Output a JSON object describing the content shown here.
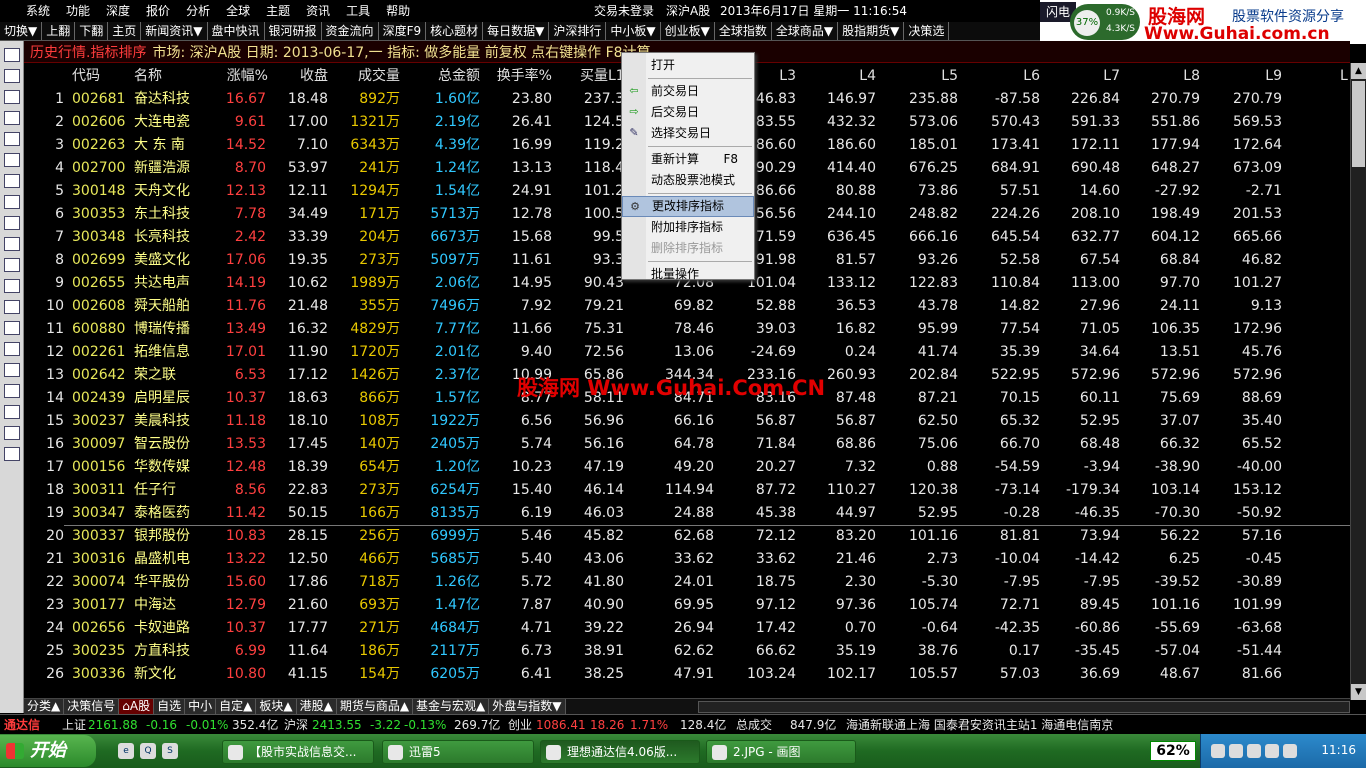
{
  "menu": [
    "系统",
    "功能",
    "深度",
    "报价",
    "分析",
    "全球",
    "主题",
    "资讯",
    "工具",
    "帮助"
  ],
  "status": {
    "trade": "交易未登录",
    "market": "深沪A股",
    "datetime": "2013年6月17日 星期一 11:16:54",
    "flash": "闪电"
  },
  "gauge": {
    "pct": "37%",
    "up": "0.9K/S",
    "down": "4.3K/S"
  },
  "brand": {
    "name": "股海网",
    "slogan": "股票软件资源分享",
    "url": "Www.Guhai.com.cn"
  },
  "toolbar": [
    "切换▼",
    "上翻",
    "下翻",
    "主页",
    "新闻资讯▼",
    "盘中快讯",
    "银河研报",
    "资金流向",
    "深度F9",
    "核心题材",
    "每日数据▼",
    "沪深排行",
    "中小板▼",
    "创业板▼",
    "全球指数",
    "全球商品▼",
    "股指期货▼",
    "决策选"
  ],
  "left_icons": [
    "list",
    "grid",
    "chart",
    "kline",
    "table",
    "fin",
    "doc",
    "doc2",
    "fin2",
    "f10",
    "search",
    "sel",
    "edit",
    "edit2",
    "note",
    "open",
    "tool",
    "back",
    "fwd",
    "setting"
  ],
  "titlebar": {
    "label": "历史行情.指标排序",
    "info": "市场: 深沪A股 日期: 2013-06-17,一 指标: 做多能量 前复权 点右键操作 F8计算"
  },
  "columns": [
    "",
    "代码",
    "名称",
    "涨幅%",
    "收盘",
    "成交量",
    "总金额",
    "换手率%",
    "买量L1",
    "L2",
    "L3",
    "L4",
    "L5",
    "L6",
    "L7",
    "L8",
    "L9",
    "L"
  ],
  "rows": [
    [
      "1",
      "002681",
      "奋达科技",
      "16.67",
      "18.48",
      "892万",
      "1.60亿",
      "23.80",
      "237.3",
      "",
      "246.83",
      "146.97",
      "235.88",
      "-87.58",
      "226.84",
      "270.79",
      "270.79"
    ],
    [
      "2",
      "002606",
      "大连电瓷",
      "9.61",
      "17.00",
      "1321万",
      "2.19亿",
      "26.41",
      "124.5",
      "",
      "183.55",
      "432.32",
      "573.06",
      "570.43",
      "591.33",
      "551.86",
      "569.53"
    ],
    [
      "3",
      "002263",
      "大 东 南",
      "14.52",
      "7.10",
      "6343万",
      "4.39亿",
      "16.99",
      "119.2",
      "",
      "186.60",
      "186.60",
      "185.01",
      "173.41",
      "172.11",
      "177.94",
      "172.64"
    ],
    [
      "4",
      "002700",
      "新疆浩源",
      "8.70",
      "53.97",
      "241万",
      "1.24亿",
      "13.13",
      "118.4",
      "",
      "390.29",
      "414.40",
      "676.25",
      "684.91",
      "690.48",
      "648.27",
      "673.09"
    ],
    [
      "5",
      "300148",
      "天舟文化",
      "12.13",
      "12.11",
      "1294万",
      "1.54亿",
      "24.91",
      "101.2",
      "",
      "86.66",
      "80.88",
      "73.86",
      "57.51",
      "14.60",
      "-27.92",
      "-2.71"
    ],
    [
      "6",
      "300353",
      "东土科技",
      "7.78",
      "34.49",
      "171万",
      "5713万",
      "12.78",
      "100.5",
      "",
      "256.56",
      "244.10",
      "248.82",
      "224.26",
      "208.10",
      "198.49",
      "201.53"
    ],
    [
      "7",
      "300348",
      "长亮科技",
      "2.42",
      "33.39",
      "204万",
      "6673万",
      "15.68",
      "99.5",
      "",
      "671.59",
      "636.45",
      "666.16",
      "645.54",
      "632.77",
      "604.12",
      "665.66"
    ],
    [
      "8",
      "002699",
      "美盛文化",
      "17.06",
      "19.35",
      "273万",
      "5097万",
      "11.61",
      "93.3",
      "",
      "91.98",
      "81.57",
      "93.26",
      "52.58",
      "67.54",
      "68.84",
      "46.82"
    ],
    [
      "9",
      "002655",
      "共达电声",
      "14.19",
      "10.62",
      "1989万",
      "2.06亿",
      "14.95",
      "90.43",
      "72.08",
      "101.04",
      "133.12",
      "122.83",
      "110.84",
      "113.00",
      "97.70",
      "101.27"
    ],
    [
      "10",
      "002608",
      "舜天船舶",
      "11.76",
      "21.48",
      "355万",
      "7496万",
      "7.92",
      "79.21",
      "69.82",
      "52.88",
      "36.53",
      "43.78",
      "14.82",
      "27.96",
      "24.11",
      "9.13"
    ],
    [
      "11",
      "600880",
      "博瑞传播",
      "13.49",
      "16.32",
      "4829万",
      "7.77亿",
      "11.66",
      "75.31",
      "78.46",
      "39.03",
      "16.82",
      "95.99",
      "77.54",
      "71.05",
      "106.35",
      "172.96"
    ],
    [
      "12",
      "002261",
      "拓维信息",
      "17.01",
      "11.90",
      "1720万",
      "2.01亿",
      "9.40",
      "72.56",
      "13.06",
      "-24.69",
      "0.24",
      "41.74",
      "35.39",
      "34.64",
      "13.51",
      "45.76"
    ],
    [
      "13",
      "002642",
      "荣之联",
      "6.53",
      "17.12",
      "1426万",
      "2.37亿",
      "10.99",
      "65.86",
      "344.34",
      "233.16",
      "260.93",
      "202.84",
      "522.95",
      "572.96",
      "572.96",
      "572.96"
    ],
    [
      "14",
      "002439",
      "启明星辰",
      "10.37",
      "18.63",
      "866万",
      "1.57亿",
      "8.77",
      "58.11",
      "84.71",
      "83.16",
      "87.48",
      "87.21",
      "70.15",
      "60.11",
      "75.69",
      "88.69"
    ],
    [
      "15",
      "300237",
      "美晨科技",
      "11.18",
      "18.10",
      "108万",
      "1922万",
      "6.56",
      "56.96",
      "66.16",
      "56.87",
      "56.87",
      "62.50",
      "65.32",
      "52.95",
      "37.07",
      "35.40"
    ],
    [
      "16",
      "300097",
      "智云股份",
      "13.53",
      "17.45",
      "140万",
      "2405万",
      "5.74",
      "56.16",
      "64.78",
      "71.84",
      "68.86",
      "75.06",
      "66.70",
      "68.48",
      "66.32",
      "65.52"
    ],
    [
      "17",
      "000156",
      "华数传媒",
      "12.48",
      "18.39",
      "654万",
      "1.20亿",
      "10.23",
      "47.19",
      "49.20",
      "20.27",
      "7.32",
      "0.88",
      "-54.59",
      "-3.94",
      "-38.90",
      "-40.00"
    ],
    [
      "18",
      "300311",
      "任子行",
      "8.56",
      "22.83",
      "273万",
      "6254万",
      "15.40",
      "46.14",
      "114.94",
      "87.72",
      "110.27",
      "120.38",
      "-73.14",
      "-179.34",
      "103.14",
      "153.12"
    ],
    [
      "19",
      "300347",
      "泰格医药",
      "11.42",
      "50.15",
      "166万",
      "8135万",
      "6.19",
      "46.03",
      "24.88",
      "45.38",
      "44.97",
      "52.95",
      "-0.28",
      "-46.35",
      "-70.30",
      "-50.92"
    ],
    [
      "20",
      "300337",
      "银邦股份",
      "10.83",
      "28.15",
      "256万",
      "6999万",
      "5.46",
      "45.82",
      "62.68",
      "72.12",
      "83.20",
      "101.16",
      "81.81",
      "73.94",
      "56.22",
      "57.16"
    ],
    [
      "21",
      "300316",
      "晶盛机电",
      "13.22",
      "12.50",
      "466万",
      "5685万",
      "5.40",
      "43.06",
      "33.62",
      "33.62",
      "21.46",
      "2.73",
      "-10.04",
      "-14.42",
      "6.25",
      "-0.45"
    ],
    [
      "22",
      "300074",
      "华平股份",
      "15.60",
      "17.86",
      "718万",
      "1.26亿",
      "5.72",
      "41.80",
      "24.01",
      "18.75",
      "2.30",
      "-5.30",
      "-7.95",
      "-7.95",
      "-39.52",
      "-30.89"
    ],
    [
      "23",
      "300177",
      "中海达",
      "12.79",
      "21.60",
      "693万",
      "1.47亿",
      "7.87",
      "40.90",
      "69.95",
      "97.12",
      "97.36",
      "105.74",
      "72.71",
      "89.45",
      "101.16",
      "101.99"
    ],
    [
      "24",
      "002656",
      "卡奴迪路",
      "10.37",
      "17.77",
      "271万",
      "4684万",
      "4.71",
      "39.22",
      "26.94",
      "17.42",
      "0.70",
      "-0.64",
      "-42.35",
      "-60.86",
      "-55.69",
      "-63.68"
    ],
    [
      "25",
      "300235",
      "方直科技",
      "6.99",
      "11.64",
      "186万",
      "2117万",
      "6.73",
      "38.91",
      "62.62",
      "66.62",
      "35.19",
      "38.76",
      "0.17",
      "-35.45",
      "-57.04",
      "-51.44"
    ],
    [
      "26",
      "300336",
      "新文化",
      "10.80",
      "41.15",
      "154万",
      "6205万",
      "6.41",
      "38.25",
      "47.91",
      "103.24",
      "102.17",
      "105.57",
      "57.03",
      "36.69",
      "48.67",
      "81.66"
    ]
  ],
  "watermark": "股海网 Www.Guhai.Com.CN",
  "context_menu": [
    {
      "label": "打开",
      "icon": "",
      "shortcut": "",
      "state": ""
    },
    {
      "divider": true
    },
    {
      "label": "前交易日",
      "icon": "left-arrow",
      "shortcut": "",
      "state": ""
    },
    {
      "label": "后交易日",
      "icon": "right-arrow",
      "shortcut": "",
      "state": ""
    },
    {
      "label": "选择交易日",
      "icon": "tool",
      "shortcut": "",
      "state": ""
    },
    {
      "divider": true
    },
    {
      "label": "重新计算",
      "icon": "",
      "shortcut": "F8",
      "state": ""
    },
    {
      "label": "动态股票池模式",
      "icon": "",
      "shortcut": "",
      "state": ""
    },
    {
      "divider": true
    },
    {
      "label": "更改排序指标",
      "icon": "setting",
      "shortcut": "",
      "state": "sel"
    },
    {
      "label": "附加排序指标",
      "icon": "",
      "shortcut": "",
      "state": ""
    },
    {
      "label": "删除排序指标",
      "icon": "",
      "shortcut": "",
      "state": "dis"
    },
    {
      "divider": true
    },
    {
      "label": "批量操作",
      "icon": "",
      "shortcut": "",
      "state": ""
    }
  ],
  "tabs": [
    "分类▲",
    "决策信号",
    "⌂A股",
    "自选",
    "中小",
    "自定▲",
    "板块▲",
    "港股▲",
    "期货与商品▲",
    "基金与宏观▲",
    "外盘与指数▼"
  ],
  "statusbar": {
    "app": "通达信",
    "sh_label": "上证",
    "sh_val": "2161.88",
    "sh_chg": "-0.16",
    "sh_pct": "-0.01%",
    "sh_amt": "352.4亿",
    "sz_label": "沪深",
    "sz_val": "2413.55",
    "sz_chg": "-3.22",
    "sz_pct": "-0.13%",
    "sz_amt": "269.7亿",
    "cy_label": "创业",
    "cy_val": "1086.41",
    "cy_chg": "18.26",
    "cy_pct": "1.71%",
    "cy_amt": "128.4亿",
    "total_label": "总成交",
    "total_amt": "847.9亿",
    "news": "海通新联通上海 国泰君安资讯主站1 海通电信南京"
  },
  "taskbar": {
    "start": "开始",
    "tasks": [
      "【股市实战信息交...",
      "迅雷5",
      "理想通达信4.06版...",
      "2.JPG - 画图"
    ],
    "percent": "62%",
    "clock": "11:16"
  },
  "colors": {
    "up": "#ff4040",
    "text": "#e8e8e8",
    "amount_yellow": "#e8c800",
    "amount_cyan": "#30c8ff"
  }
}
